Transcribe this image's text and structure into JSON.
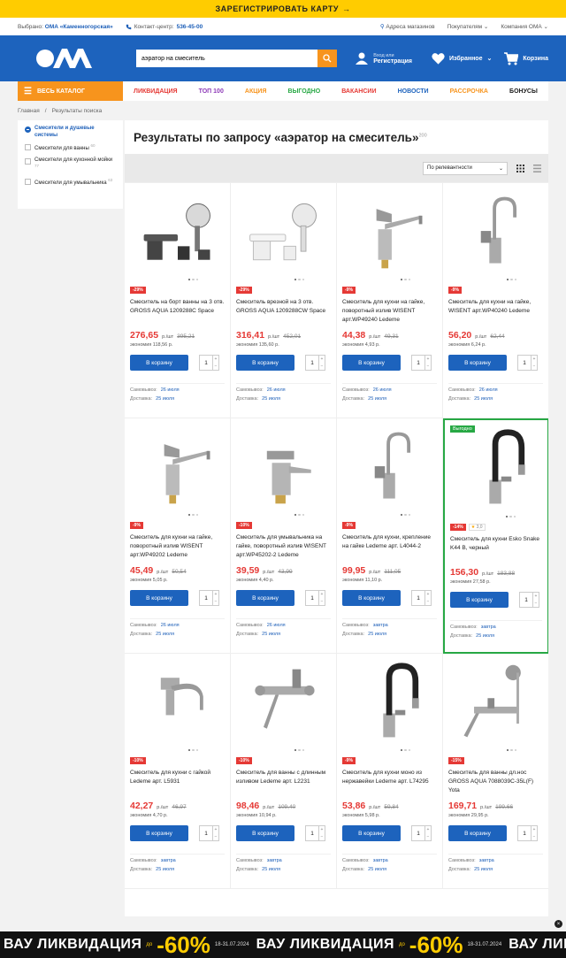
{
  "banner": "ЗАРЕГИСТРИРОВАТЬ КАРТУ",
  "topbar": {
    "selected_label": "Выбрано:",
    "selected_store": "ОМА «Каменногорская»",
    "contact_label": "Контакт-центр:",
    "contact_phone": "536-45-00",
    "links": [
      "Адреса магазинов",
      "Покупателям",
      "Компания ОМА"
    ]
  },
  "header": {
    "logo": "ОМА",
    "search_value": "аэратор на смеситель",
    "login_small": "Вход или",
    "login": "Регистрация",
    "favorites": "Избранное",
    "cart": "Корзина"
  },
  "nav": {
    "catalog": "ВЕСЬ КАТАЛОГ",
    "links": [
      {
        "label": "ЛИКВИДАЦИЯ",
        "color": "#e53935"
      },
      {
        "label": "ТОП 100",
        "color": "#8e3bb8"
      },
      {
        "label": "АКЦИЯ",
        "color": "#f7941d"
      },
      {
        "label": "ВЫГОДНО",
        "color": "#27a844"
      },
      {
        "label": "ВАКАНСИИ",
        "color": "#e53935"
      },
      {
        "label": "НОВОСТИ",
        "color": "#1d63bd"
      },
      {
        "label": "РАССРОЧКА",
        "color": "#f7941d"
      },
      {
        "label": "БОНУСЫ",
        "color": "#222222"
      }
    ]
  },
  "breadcrumbs": [
    "Главная",
    "Результаты поиска"
  ],
  "sidebar": {
    "items": [
      {
        "label": "Смесители и душевые системы",
        "count": "",
        "active": true
      },
      {
        "label": "Смесители для ванны",
        "count": "60",
        "active": false
      },
      {
        "label": "Смесители для кухонной мойки",
        "count": "77",
        "active": false
      },
      {
        "label": "Смесители для умывальника",
        "count": "63",
        "active": false
      }
    ]
  },
  "results": {
    "title": "Результаты по запросу «аэратор на смеситель»",
    "count": "200",
    "sort": "По релевантности"
  },
  "labels": {
    "buy": "В корзину",
    "pickup": "Самовывоз:",
    "delivery": "Доставка:",
    "unit": "р./шт",
    "economy": "экономия",
    "qty": "1"
  },
  "products": [
    {
      "name": "Смеситель на борт ванны на 3 отв. GROSS AQUA 1209288C Space",
      "discount": "-29%",
      "price": "276,65",
      "old": "395,21",
      "save": "118,56 р.",
      "pickup": "26 июля",
      "delivery": "25 июля",
      "icon": "bath-deck-mixer-icon"
    },
    {
      "name": "Смеситель врезной на 3 отв. GROSS AQUA 1209288CW Space",
      "discount": "-29%",
      "price": "316,41",
      "old": "452,01",
      "save": "135,60 р.",
      "pickup": "26 июля",
      "delivery": "25 июля",
      "icon": "white-deck-mixer-icon"
    },
    {
      "name": "Смеситель для кухни на гайке, поворотный излив WISENT арт.WP49240 Ledeme",
      "discount": "-9%",
      "price": "44,38",
      "old": "49,31",
      "save": "4,93 р.",
      "pickup": "26 июля",
      "delivery": "25 июля",
      "icon": "kitchen-mixer-icon"
    },
    {
      "name": "Смеситель для кухни на гайке, WISENT арт.WP40240 Ledeme",
      "discount": "-9%",
      "price": "56,20",
      "old": "62,44",
      "save": "6,24 р.",
      "pickup": "26 июля",
      "delivery": "25 июля",
      "icon": "gooseneck-mixer-icon"
    },
    {
      "name": "Смеситель для кухни на гайке, поворотный излив WISENT арт.WP49202 Ledeme",
      "discount": "-9%",
      "price": "45,49",
      "old": "50,54",
      "save": "5,05 р.",
      "pickup": "26 июля",
      "delivery": "25 июля",
      "icon": "kitchen-mixer-icon"
    },
    {
      "name": "Смеситель для умывальника на гайке, поворотный излив WISENT арт.WP45202-2 Ledeme",
      "discount": "-10%",
      "price": "39,59",
      "old": "43,99",
      "save": "4,40 р.",
      "pickup": "26 июля",
      "delivery": "25 июля",
      "icon": "basin-mixer-icon"
    },
    {
      "name": "Смеситель для кухни, крепление на гайке Ledeme арт. L4044-2",
      "discount": "-9%",
      "price": "99,95",
      "old": "111,05",
      "save": "11,10 р.",
      "pickup": "завтра",
      "delivery": "25 июля",
      "icon": "gooseneck-mixer-icon"
    },
    {
      "name": "Смеситель для кухни Esko Snake K44 B, черный",
      "discount": "-14%",
      "rating": "3,0",
      "promo": "Выгодно",
      "price": "156,30",
      "old": "183,88",
      "save": "27,58 р.",
      "pickup": "завтра",
      "delivery": "25 июля",
      "icon": "flexible-spout-mixer-icon",
      "highlight": true
    },
    {
      "name": "Смеситель для кухни с гайкой Ledeme арт. L5931",
      "discount": "-10%",
      "price": "42,27",
      "old": "46,97",
      "save": "4,70 р.",
      "pickup": "завтра",
      "delivery": "25 июля",
      "icon": "wall-spout-mixer-icon"
    },
    {
      "name": "Смеситель для ванны с длинным изливом Ledeme арт. L2231",
      "discount": "-10%",
      "price": "98,46",
      "old": "109,40",
      "save": "10,94 р.",
      "pickup": "завтра",
      "delivery": "25 июля",
      "icon": "bath-long-spout-icon"
    },
    {
      "name": "Смеситель для кухни моно из нержавейки Ledeme арт. L74295",
      "discount": "-9%",
      "price": "53,86",
      "old": "59,84",
      "save": "5,98 р.",
      "pickup": "завтра",
      "delivery": "25 июля",
      "icon": "flexible-spout-mixer-icon"
    },
    {
      "name": "Смеситель для ванны дл.нос GROSS AQUA 7088039C-35L(F) Yota",
      "discount": "-15%",
      "price": "169,71",
      "old": "199,66",
      "save": "29,95 р.",
      "pickup": "завтра",
      "delivery": "25 июля",
      "icon": "bath-shower-set-icon"
    }
  ],
  "bottom_banner": {
    "word1": "ВАУ",
    "word2": "ЛИКВИДАЦИЯ",
    "prefix": "до",
    "percent": "-60%",
    "dates": "18-31.07.2024"
  },
  "colors": {
    "brand_blue": "#1d63bd",
    "orange": "#f7941d",
    "yellow": "#ffcc00",
    "red": "#e53935",
    "green": "#27a844"
  }
}
